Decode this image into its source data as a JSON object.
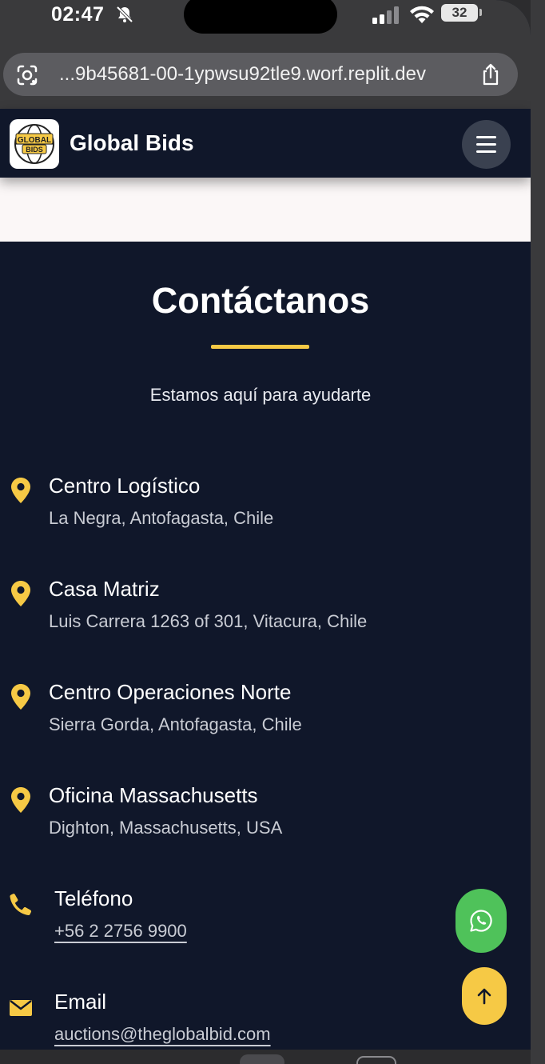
{
  "status_bar": {
    "time": "02:47",
    "battery": "32"
  },
  "browser": {
    "url": "...9b45681-00-1ypwsu92tle9.worf.replit.dev"
  },
  "header": {
    "logo_text_top": "GLOBAL",
    "logo_text_bottom": "BIDS",
    "brand": "Global Bids"
  },
  "contact": {
    "title": "Contáctanos",
    "subtitle": "Estamos aquí para ayudarte",
    "items": [
      {
        "label": "Centro Logístico",
        "value": "La Negra, Antofagasta, Chile",
        "icon": "map-pin-icon"
      },
      {
        "label": "Casa Matriz",
        "value": "Luis Carrera 1263 of 301, Vitacura, Chile",
        "icon": "map-pin-icon"
      },
      {
        "label": "Centro Operaciones Norte",
        "value": "Sierra Gorda, Antofagasta, Chile",
        "icon": "map-pin-icon"
      },
      {
        "label": "Oficina Massachusetts",
        "value": "Dighton, Massachusetts, USA",
        "icon": "map-pin-icon"
      },
      {
        "label": "Teléfono",
        "value": "+56 2 2756 9900",
        "icon": "phone-icon"
      },
      {
        "label": "Email",
        "value": "auctions@theglobalbid.com",
        "icon": "envelope-icon"
      }
    ]
  },
  "colors": {
    "accent": "#f6c945",
    "background": "#10172a",
    "whatsapp": "#4fc25a"
  }
}
